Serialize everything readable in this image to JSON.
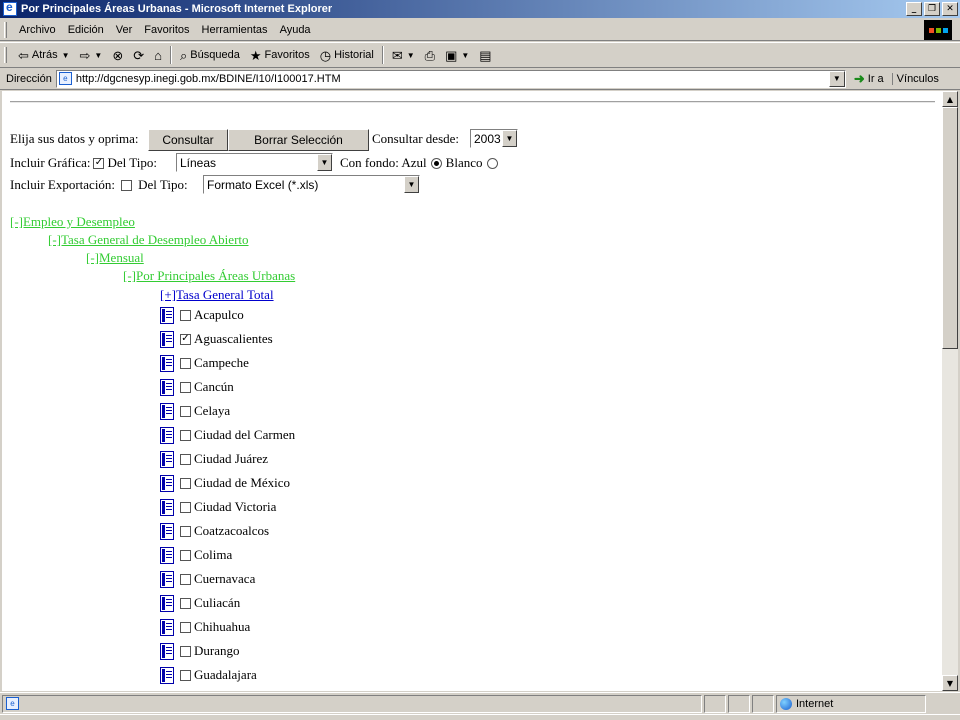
{
  "window": {
    "title": "Por Principales Áreas Urbanas - Microsoft Internet Explorer"
  },
  "menu": [
    "Archivo",
    "Edición",
    "Ver",
    "Favoritos",
    "Herramientas",
    "Ayuda"
  ],
  "toolbar": {
    "back": "Atrás",
    "search": "Búsqueda",
    "favorites": "Favoritos",
    "history": "Historial"
  },
  "address": {
    "label": "Dirección",
    "url": "http://dgcnesyp.inegi.gob.mx/BDINE/I10/I100017.HTM",
    "go": "Ir a",
    "links": "Vínculos"
  },
  "form": {
    "prompt": "Elija sus datos y oprima:",
    "consultar": "Consultar",
    "borrar": "Borrar Selección",
    "consultar_desde": "Consultar desde:",
    "year": "2003",
    "incluir_grafica": "Incluir Gráfica:",
    "grafica_checked": true,
    "del_tipo": "Del Tipo:",
    "tipo_grafica": "Líneas",
    "con_fondo": "Con fondo: Azul",
    "fondo_azul_selected": true,
    "blanco": "Blanco",
    "incluir_exportacion": "Incluir Exportación:",
    "exportacion_checked": false,
    "del_tipo2": "Del Tipo:",
    "tipo_export": "Formato Excel (*.xls)"
  },
  "tree": {
    "l1": "[-]Empleo y Desempleo",
    "l2": "[-]Tasa General de Desempleo Abierto",
    "l3": "[-]Mensual",
    "l4": "[-]Por Principales Áreas Urbanas",
    "l5": "[+]Tasa General Total"
  },
  "cities": [
    {
      "name": "Acapulco",
      "checked": false
    },
    {
      "name": "Aguascalientes",
      "checked": true
    },
    {
      "name": "Campeche",
      "checked": false
    },
    {
      "name": "Cancún",
      "checked": false
    },
    {
      "name": "Celaya",
      "checked": false
    },
    {
      "name": "Ciudad del Carmen",
      "checked": false
    },
    {
      "name": "Ciudad Juárez",
      "checked": false
    },
    {
      "name": "Ciudad de México",
      "checked": false
    },
    {
      "name": "Ciudad Victoria",
      "checked": false
    },
    {
      "name": "Coatzacoalcos",
      "checked": false
    },
    {
      "name": "Colima",
      "checked": false
    },
    {
      "name": "Cuernavaca",
      "checked": false
    },
    {
      "name": "Culiacán",
      "checked": false
    },
    {
      "name": "Chihuahua",
      "checked": false
    },
    {
      "name": "Durango",
      "checked": false
    },
    {
      "name": "Guadalajara",
      "checked": false
    }
  ],
  "status": {
    "zone": "Internet"
  },
  "colors": {
    "tree_link": "#33cc33",
    "tree_link_active": "#0000cc",
    "title_bar": "#0a246a"
  }
}
